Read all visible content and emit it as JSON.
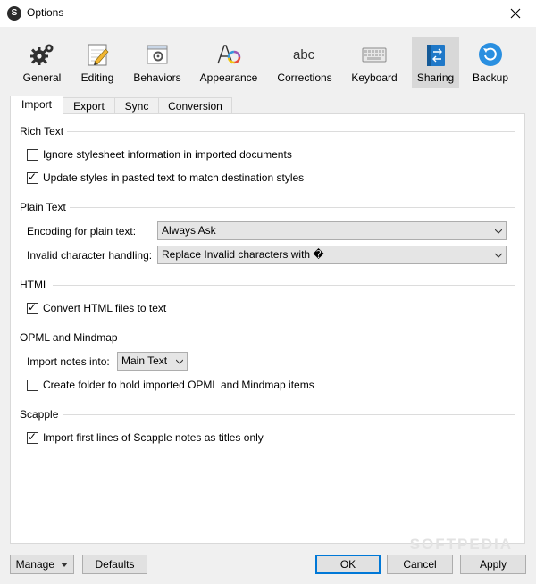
{
  "window": {
    "title": "Options",
    "app_icon_glyph": "S"
  },
  "toolbar": {
    "items": [
      {
        "label": "General",
        "icon": "gears-icon"
      },
      {
        "label": "Editing",
        "icon": "notepad-pencil-icon"
      },
      {
        "label": "Behaviors",
        "icon": "window-gear-icon"
      },
      {
        "label": "Appearance",
        "icon": "font-color-icon"
      },
      {
        "label": "Corrections",
        "icon": "abc-icon",
        "icon_text": "abc"
      },
      {
        "label": "Keyboard",
        "icon": "keyboard-icon"
      },
      {
        "label": "Sharing",
        "icon": "sharing-arrows-icon",
        "selected": true
      },
      {
        "label": "Backup",
        "icon": "backup-icon"
      }
    ]
  },
  "tabs": [
    {
      "label": "Import",
      "active": true
    },
    {
      "label": "Export"
    },
    {
      "label": "Sync"
    },
    {
      "label": "Conversion"
    }
  ],
  "rich_text": {
    "title": "Rich Text",
    "ignore_stylesheet": {
      "label": "Ignore stylesheet information in imported documents",
      "checked": false
    },
    "update_styles": {
      "label": "Update styles in pasted text to match destination styles",
      "checked": true
    }
  },
  "plain_text": {
    "title": "Plain Text",
    "encoding_label": "Encoding for plain text:",
    "encoding_value": "Always Ask",
    "invalid_label": "Invalid character handling:",
    "invalid_value": "Replace Invalid characters with �"
  },
  "html": {
    "title": "HTML",
    "convert": {
      "label": "Convert HTML files to text",
      "checked": true
    }
  },
  "opml": {
    "title": "OPML and Mindmap",
    "import_label": "Import notes into:",
    "import_value": "Main Text",
    "create_folder": {
      "label": "Create folder to hold imported OPML and Mindmap items",
      "checked": false
    }
  },
  "scapple": {
    "title": "Scapple",
    "first_lines": {
      "label": "Import first lines of Scapple notes as titles only",
      "checked": true
    }
  },
  "buttons": {
    "manage": "Manage",
    "defaults": "Defaults",
    "ok": "OK",
    "cancel": "Cancel",
    "apply": "Apply"
  },
  "watermark": "SOFTPEDIA",
  "colors": {
    "selected_bg": "#d8d8d8",
    "accent": "#0078d7"
  }
}
